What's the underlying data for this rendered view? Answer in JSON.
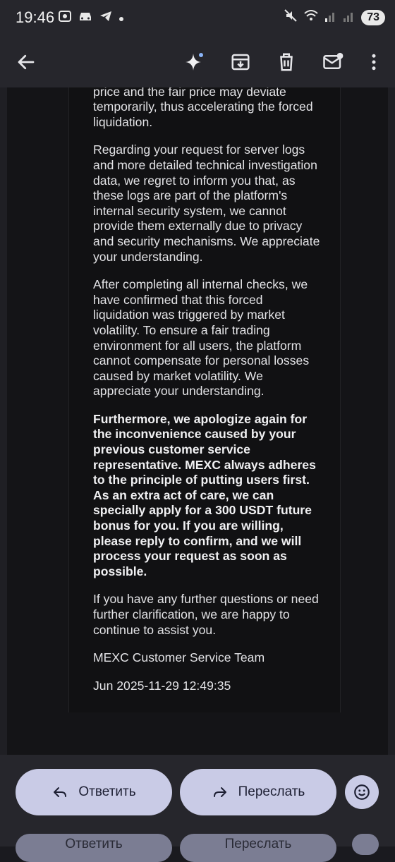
{
  "status_bar": {
    "time": "19:46",
    "battery": "73",
    "left_icons": [
      "camera-icon",
      "car-icon",
      "telegram-icon",
      "dot-icon"
    ],
    "right_icons": [
      "mute-icon",
      "wifi-icon",
      "signal-icon",
      "signal-icon"
    ]
  },
  "app_bar": {
    "actions": [
      "back-icon",
      "sparkle-icon",
      "archive-icon",
      "delete-icon",
      "mark-unread-icon",
      "more-icon"
    ]
  },
  "message": {
    "paragraphs": [
      "In extreme market conditions, the market price and the fair price may deviate temporarily, thus accelerating the forced liquidation.",
      "Regarding your request for server logs and more detailed technical investigation data, we regret to inform you that, as these logs are part of the platform's internal security system, we cannot provide them externally due to privacy and security mechanisms. We appreciate your understanding.",
      "After completing all internal checks, we have confirmed that this forced liquidation was triggered by market volatility. To ensure a fair trading environment for all users, the platform cannot compensate for personal losses caused by market volatility. We appreciate your understanding.",
      "Furthermore, we apologize again for the inconvenience caused by your previous customer service representative. MEXC always adheres to the principle of putting users first. As an extra act of care, we can specially apply for a 300 USDT future bonus for you. If you are willing, please reply to confirm, and we will process your request as soon as possible.",
      "If you have any further questions or need further clarification, we are happy to continue to assist you.",
      "MEXC Customer Service Team",
      "Jun 2025-11-29 12:49:35"
    ]
  },
  "bottom_bar": {
    "reply_label": "Ответить",
    "forward_label": "Переслать",
    "ghost_reply_label": "Ответить",
    "ghost_forward_label": "Переслать"
  },
  "colors": {
    "background": "#1a1a1f",
    "bar": "#26262c",
    "pill": "#c9cbe6",
    "accent_dot": "#8ab4f8"
  }
}
